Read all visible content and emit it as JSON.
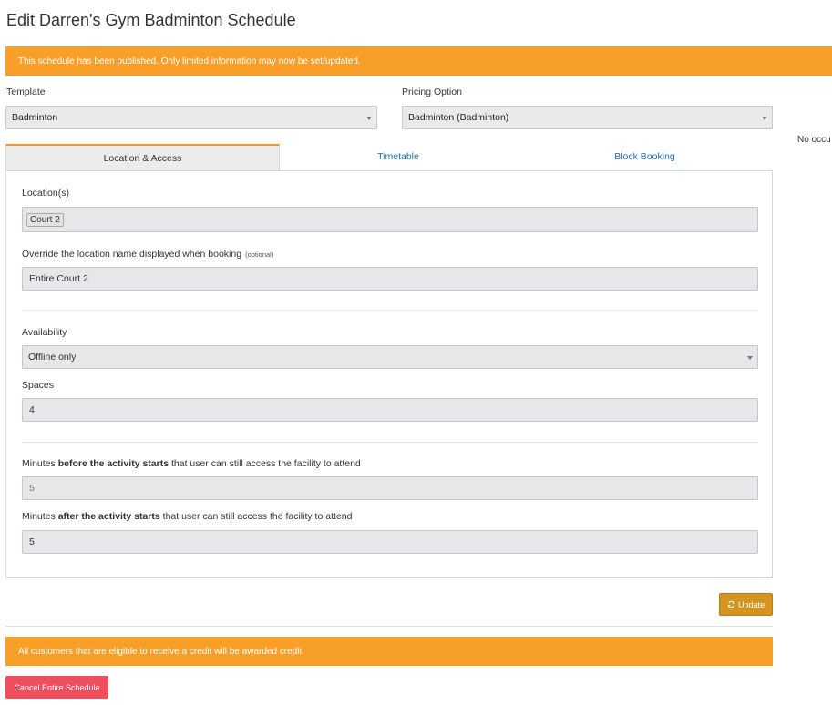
{
  "page": {
    "title": "Edit Darren's Gym Badminton Schedule"
  },
  "alerts": {
    "published": "This schedule has been published. Only limited information may now be set/updated.",
    "credit": "All customers that are eligible to receive a credit will be awarded credit."
  },
  "template": {
    "label": "Template",
    "value": "Badminton"
  },
  "pricing": {
    "label": "Pricing Option",
    "value": "Badminton (Badminton)"
  },
  "side_note": "No occu",
  "tabs": [
    {
      "label": "Location & Access",
      "active": true
    },
    {
      "label": "Timetable",
      "active": false
    },
    {
      "label": "Block Booking",
      "active": false
    }
  ],
  "location": {
    "locations_label": "Location(s)",
    "locations": [
      "Court 2"
    ],
    "override_label": "Override the location name displayed when booking",
    "override_optional": "(optional)",
    "override_value": "Entire Court 2"
  },
  "availability": {
    "label": "Availability",
    "value": "Offline only"
  },
  "spaces": {
    "label": "Spaces",
    "value": "4"
  },
  "access_before": {
    "label_prefix": "Minutes ",
    "label_bold": "before the activity starts",
    "label_suffix": " that user can still access the facility to attend",
    "value": "5"
  },
  "access_after": {
    "label_prefix": "Minutes ",
    "label_bold": "after the activity starts",
    "label_suffix": " that user can still access the facility to attend",
    "value": "5"
  },
  "buttons": {
    "update": "Update",
    "cancel_schedule": "Cancel Entire Schedule"
  },
  "colors": {
    "alert": "#f89f29",
    "update_button": "#d49422",
    "cancel_button": "#f04e5e",
    "tab_accent": "#f0982b",
    "link": "#1d6fa3"
  },
  "icons": {
    "update": "refresh-icon",
    "select": "caret-down-icon"
  }
}
